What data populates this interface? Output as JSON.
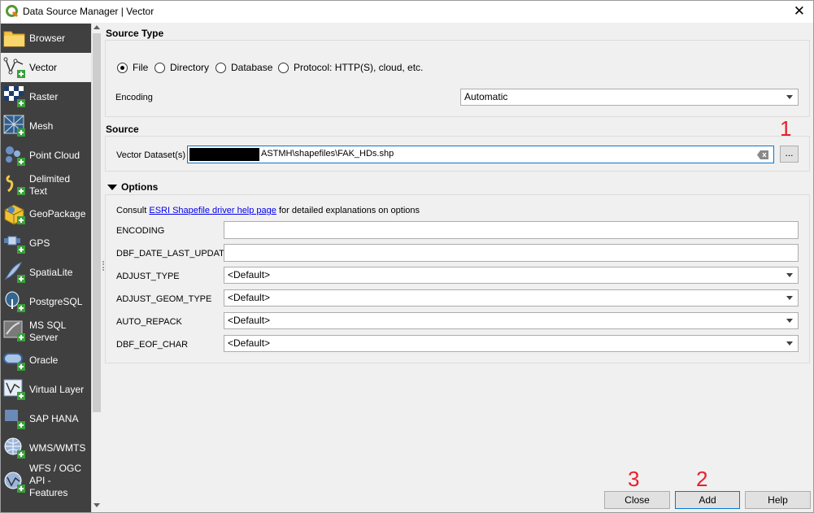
{
  "window": {
    "title": "Data Source Manager | Vector",
    "close_glyph": "✕"
  },
  "sidebar": {
    "items": [
      {
        "label": "Browser",
        "icon": "folder-icon"
      },
      {
        "label": "Vector",
        "icon": "vector-add-icon"
      },
      {
        "label": "Raster",
        "icon": "raster-add-icon"
      },
      {
        "label": "Mesh",
        "icon": "mesh-add-icon"
      },
      {
        "label": "Point Cloud",
        "icon": "point-cloud-add-icon"
      },
      {
        "label": "Delimited Text",
        "line1": "Delimited",
        "line2": "Text",
        "icon": "delimited-text-add-icon"
      },
      {
        "label": "GeoPackage",
        "icon": "geopackage-add-icon"
      },
      {
        "label": "GPS",
        "icon": "gps-add-icon"
      },
      {
        "label": "SpatiaLite",
        "icon": "spatialite-add-icon"
      },
      {
        "label": "PostgreSQL",
        "icon": "postgresql-add-icon"
      },
      {
        "label": "MS SQL Server",
        "line1": "MS SQL",
        "line2": "Server",
        "icon": "mssql-add-icon"
      },
      {
        "label": "Oracle",
        "icon": "oracle-add-icon"
      },
      {
        "label": "Virtual Layer",
        "icon": "virtual-layer-add-icon"
      },
      {
        "label": "SAP HANA",
        "icon": "sap-hana-add-icon"
      },
      {
        "label": "WMS/WMTS",
        "icon": "wms-add-icon"
      },
      {
        "label": "WFS / OGC API - Features",
        "line1": "WFS / OGC",
        "line2": "API -",
        "line3": "Features",
        "icon": "wfs-add-icon"
      }
    ],
    "active": "Vector"
  },
  "source_type": {
    "title": "Source Type",
    "options": [
      "File",
      "Directory",
      "Database",
      "Protocol: HTTP(S), cloud, etc."
    ],
    "selected": "File",
    "encoding_label": "Encoding",
    "encoding_value": "Automatic"
  },
  "source": {
    "title": "Source",
    "dataset_label": "Vector Dataset(s)",
    "dataset_value": "ASTMH\\shapefiles\\FAK_HDs.shp",
    "browse_label": "..."
  },
  "options": {
    "title": "Options",
    "consult_prefix": "Consult ",
    "consult_link": "ESRI Shapefile driver help page",
    "consult_suffix": " for detailed explanations on options",
    "fields": [
      {
        "label": "ENCODING",
        "type": "text",
        "value": ""
      },
      {
        "label": "DBF_DATE_LAST_UPDATE",
        "type": "text",
        "value": ""
      },
      {
        "label": "ADJUST_TYPE",
        "type": "combo",
        "value": "<Default>"
      },
      {
        "label": "ADJUST_GEOM_TYPE",
        "type": "combo",
        "value": "<Default>"
      },
      {
        "label": "AUTO_REPACK",
        "type": "combo",
        "value": "<Default>"
      },
      {
        "label": "DBF_EOF_CHAR",
        "type": "combo",
        "value": "<Default>"
      }
    ]
  },
  "buttons": {
    "close": "Close",
    "add": "Add",
    "help": "Help"
  },
  "annotations": {
    "one": "1",
    "two": "2",
    "three": "3"
  },
  "colors": {
    "sidebar_bg": "#404040",
    "annotation_red": "#e8202a",
    "focus_blue": "#0078d7",
    "link_blue": "#0000ee"
  }
}
